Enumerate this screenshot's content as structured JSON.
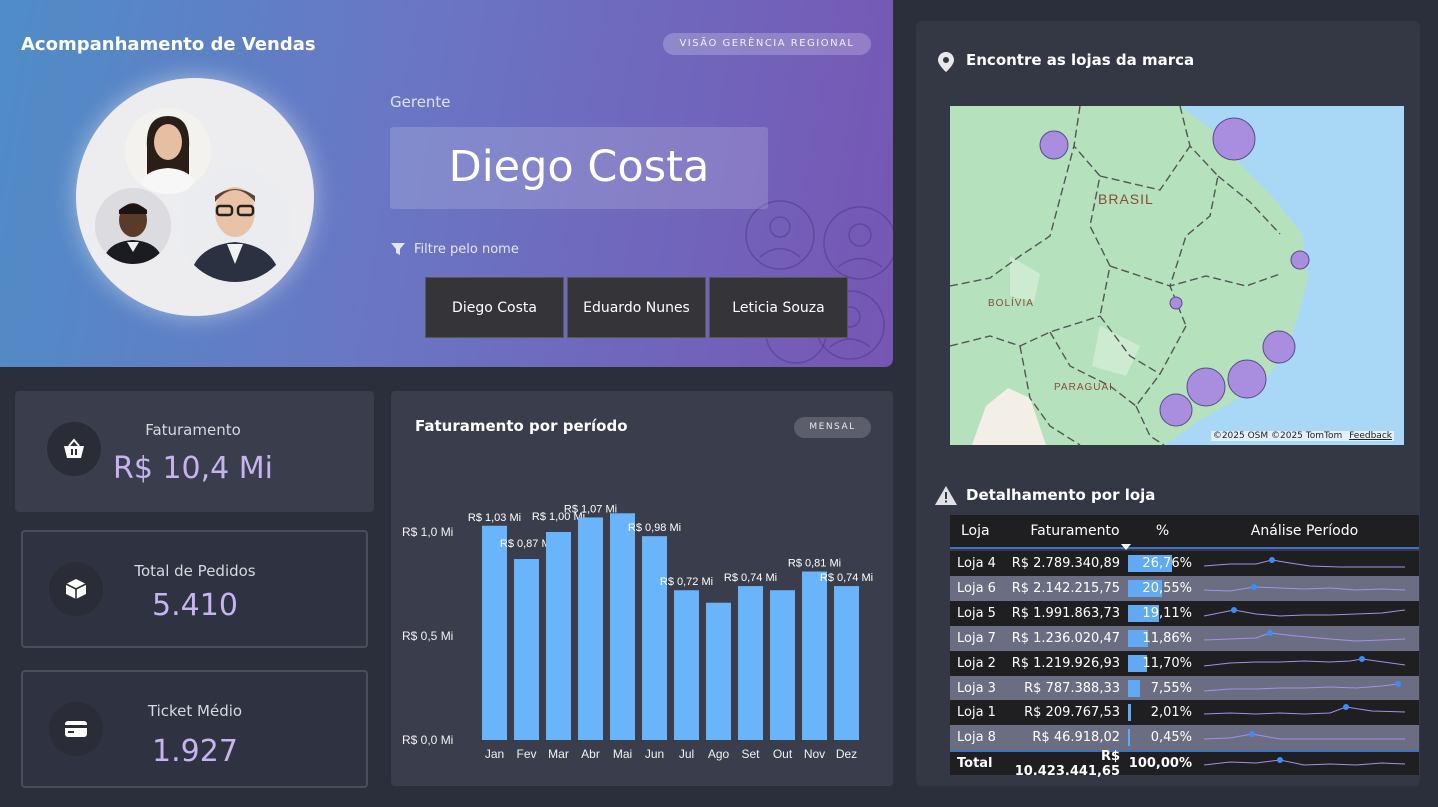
{
  "header": {
    "title": "Acompanhamento de Vendas",
    "badge": "VISÃO GERÊNCIA REGIONAL",
    "gerente_label": "Gerente",
    "selected_name": "Diego Costa",
    "filter_label": "Filtre pelo nome",
    "managers": [
      "Diego Costa",
      "Eduardo Nunes",
      "Leticia Souza"
    ]
  },
  "kpis": [
    {
      "label": "Faturamento",
      "value": "R$ 10,4 Mi",
      "icon": "basket-icon"
    },
    {
      "label": "Total de Pedidos",
      "value": "5.410",
      "icon": "box-icon"
    },
    {
      "label": "Ticket Médio",
      "value": "1.927",
      "icon": "card-icon"
    }
  ],
  "bar_panel": {
    "title": "Faturamento por período",
    "badge": "MENSAL"
  },
  "chart_data": {
    "type": "bar",
    "title": "Faturamento por período",
    "categories": [
      "Jan",
      "Fev",
      "Mar",
      "Abr",
      "Mai",
      "Jun",
      "Jul",
      "Ago",
      "Set",
      "Out",
      "Nov",
      "Dez"
    ],
    "values": [
      1.03,
      0.87,
      1.0,
      1.07,
      1.09,
      0.98,
      0.72,
      0.66,
      0.74,
      0.72,
      0.81,
      0.74
    ],
    "data_labels": [
      "R$ 1,03 Mi",
      "R$ 0,87 Mi",
      "R$ 1,00 Mi",
      "R$ 1,07 Mi",
      "",
      "R$ 0,98 Mi",
      "R$ 0,72 Mi",
      "",
      "R$ 0,74 Mi",
      "",
      "R$ 0,81 Mi",
      "R$ 0,74 Mi"
    ],
    "y_ticks": [
      {
        "value": 1.0,
        "label": "R$ 1,0 Mi"
      },
      {
        "value": 0.5,
        "label": "R$ 0,5 Mi"
      },
      {
        "value": 0.0,
        "label": "R$ 0,0 Mi"
      }
    ],
    "ylim": [
      0,
      1.0
    ],
    "grid": false,
    "bar_color": "#6ab4fb"
  },
  "map": {
    "title": "Encontre as lojas da marca",
    "labels": [
      "BRASIL",
      "BOLÍVIA",
      "PARAGUAI"
    ],
    "attribution": "©2025 OSM  ©2025 TomTom",
    "feedback": "Feedback"
  },
  "table": {
    "title": "Detalhamento por loja",
    "headers": [
      "Loja",
      "Faturamento",
      "%",
      "Análise Período"
    ],
    "rows": [
      {
        "loja": "Loja 4",
        "fat": "R$ 2.789.340,89",
        "pct": "26,76%",
        "v": 26.76
      },
      {
        "loja": "Loja 6",
        "fat": "R$ 2.142.215,75",
        "pct": "20,55%",
        "v": 20.55
      },
      {
        "loja": "Loja 5",
        "fat": "R$ 1.991.863,73",
        "pct": "19,11%",
        "v": 19.11
      },
      {
        "loja": "Loja 7",
        "fat": "R$ 1.236.020,47",
        "pct": "11,86%",
        "v": 11.86
      },
      {
        "loja": "Loja 2",
        "fat": "R$ 1.219.926,93",
        "pct": "11,70%",
        "v": 11.7
      },
      {
        "loja": "Loja 3",
        "fat": "R$ 787.388,33",
        "pct": "7,55%",
        "v": 7.55
      },
      {
        "loja": "Loja 1",
        "fat": "R$ 209.767,53",
        "pct": "2,01%",
        "v": 2.01
      },
      {
        "loja": "Loja 8",
        "fat": "R$ 46.918,02",
        "pct": "0,45%",
        "v": 0.45
      }
    ],
    "total": {
      "loja": "Total",
      "fat": "R$ 10.423.441,65",
      "pct": "100,00%"
    }
  },
  "colors": {
    "accent": "#c6b3ef",
    "bar": "#6ab4fb",
    "row_alt": "#6b6e83",
    "row_dark": "#1f1f22"
  }
}
